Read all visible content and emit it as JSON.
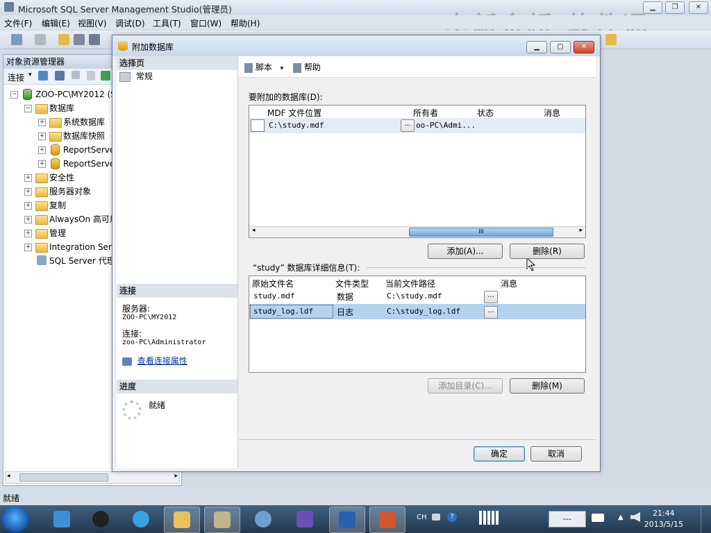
{
  "window": {
    "title": "Microsoft SQL Server Management Studio(管理员)"
  },
  "watermark": "中新金桥 软件通",
  "menu": [
    "文件(F)",
    "编辑(E)",
    "视图(V)",
    "调试(D)",
    "工具(T)",
    "窗口(W)",
    "帮助(H)"
  ],
  "object_explorer": {
    "title": "对象资源管理器",
    "connect_label": "连接",
    "tree": [
      {
        "label": "ZOO-PC\\MY2012 (S",
        "level": 0
      },
      {
        "label": "数据库",
        "level": 1
      },
      {
        "label": "系统数据库",
        "level": 2
      },
      {
        "label": "数据库快照",
        "level": 2
      },
      {
        "label": "ReportServer",
        "level": 2
      },
      {
        "label": "ReportServer",
        "level": 2
      },
      {
        "label": "安全性",
        "level": 1
      },
      {
        "label": "服务器对象",
        "level": 1
      },
      {
        "label": "复制",
        "level": 1
      },
      {
        "label": "AlwaysOn 高可用",
        "level": 1
      },
      {
        "label": "管理",
        "level": 1
      },
      {
        "label": "Integration Serv",
        "level": 1
      },
      {
        "label": "SQL Server 代理",
        "level": 1
      }
    ]
  },
  "status_bar": {
    "text": "就绪"
  },
  "dialog": {
    "title": "附加数据库",
    "select_page_label": "选择页",
    "pages": [
      "常规"
    ],
    "connection_section": "连接",
    "server_label": "服务器:",
    "server_value": "ZOO-PC\\MY2012",
    "connection_label": "连接:",
    "connection_value": "zoo-PC\\Administrator",
    "view_conn_props": "查看连接属性",
    "progress_section": "进度",
    "progress_status": "就绪",
    "script_label": "脚本",
    "help_label": "帮助",
    "attach_list_label": "要附加的数据库(D):",
    "attach_columns": [
      "MDF 文件位置",
      "所有者",
      "状态",
      "消息"
    ],
    "attach_rows": [
      {
        "mdf": "C:\\study.mdf",
        "owner": "oo-PC\\Admi...",
        "status": "",
        "message": ""
      }
    ],
    "add_button": "添加(A)...",
    "remove_button": "删除(R)",
    "details_label": "“study” 数据库详细信息(T):",
    "detail_columns": [
      "原始文件名",
      "文件类型",
      "当前文件路径",
      "消息"
    ],
    "detail_rows": [
      {
        "name": "study.mdf",
        "type": "数据",
        "path": "C:\\study.mdf",
        "message": ""
      },
      {
        "name": "study_log.ldf",
        "type": "日志",
        "path": "C:\\study_log.ldf",
        "message": ""
      }
    ],
    "add_catalog_button": "添加目录(C)...",
    "remove_detail_button": "删除(M)",
    "ok_button": "确定",
    "cancel_button": "取消"
  },
  "taskbar": {
    "input_lang": "CH",
    "clock_time": "21:44",
    "clock_date": "2013/5/15",
    "battery_text": "---"
  },
  "colors": {
    "selection": "#b4d2ee",
    "titlebar": "#c9d8ec",
    "taskbar": "#2c4560"
  }
}
